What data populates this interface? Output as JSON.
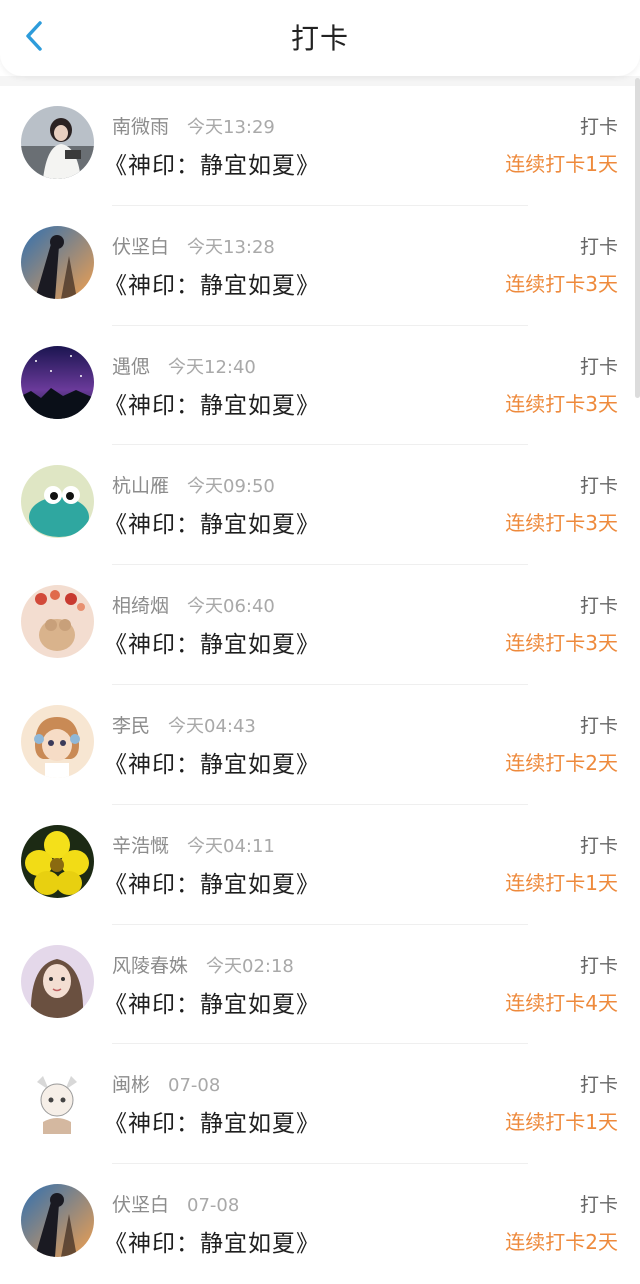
{
  "header": {
    "title": "打卡"
  },
  "colors": {
    "accent_orange": "#ee8a3c",
    "back_arrow_blue": "#2d9cdb"
  },
  "items": [
    {
      "name": "南微雨",
      "time": "今天13:29",
      "book": "《神印：静宜如夏》",
      "action": "打卡",
      "streak": "连续打卡1天"
    },
    {
      "name": "伏坚白",
      "time": "今天13:28",
      "book": "《神印：静宜如夏》",
      "action": "打卡",
      "streak": "连续打卡3天"
    },
    {
      "name": "遇偲",
      "time": "今天12:40",
      "book": "《神印：静宜如夏》",
      "action": "打卡",
      "streak": "连续打卡3天"
    },
    {
      "name": "杭山雁",
      "time": "今天09:50",
      "book": "《神印：静宜如夏》",
      "action": "打卡",
      "streak": "连续打卡3天"
    },
    {
      "name": "相绮烟",
      "time": "今天06:40",
      "book": "《神印：静宜如夏》",
      "action": "打卡",
      "streak": "连续打卡3天"
    },
    {
      "name": "李民",
      "time": "今天04:43",
      "book": "《神印：静宜如夏》",
      "action": "打卡",
      "streak": "连续打卡2天"
    },
    {
      "name": "辛浩慨",
      "time": "今天04:11",
      "book": "《神印：静宜如夏》",
      "action": "打卡",
      "streak": "连续打卡1天"
    },
    {
      "name": "风陵春姝",
      "time": "今天02:18",
      "book": "《神印：静宜如夏》",
      "action": "打卡",
      "streak": "连续打卡4天"
    },
    {
      "name": "闽彬",
      "time": "07-08",
      "book": "《神印：静宜如夏》",
      "action": "打卡",
      "streak": "连续打卡1天"
    },
    {
      "name": "伏坚白",
      "time": "07-08",
      "book": "《神印：静宜如夏》",
      "action": "打卡",
      "streak": "连续打卡2天"
    }
  ]
}
